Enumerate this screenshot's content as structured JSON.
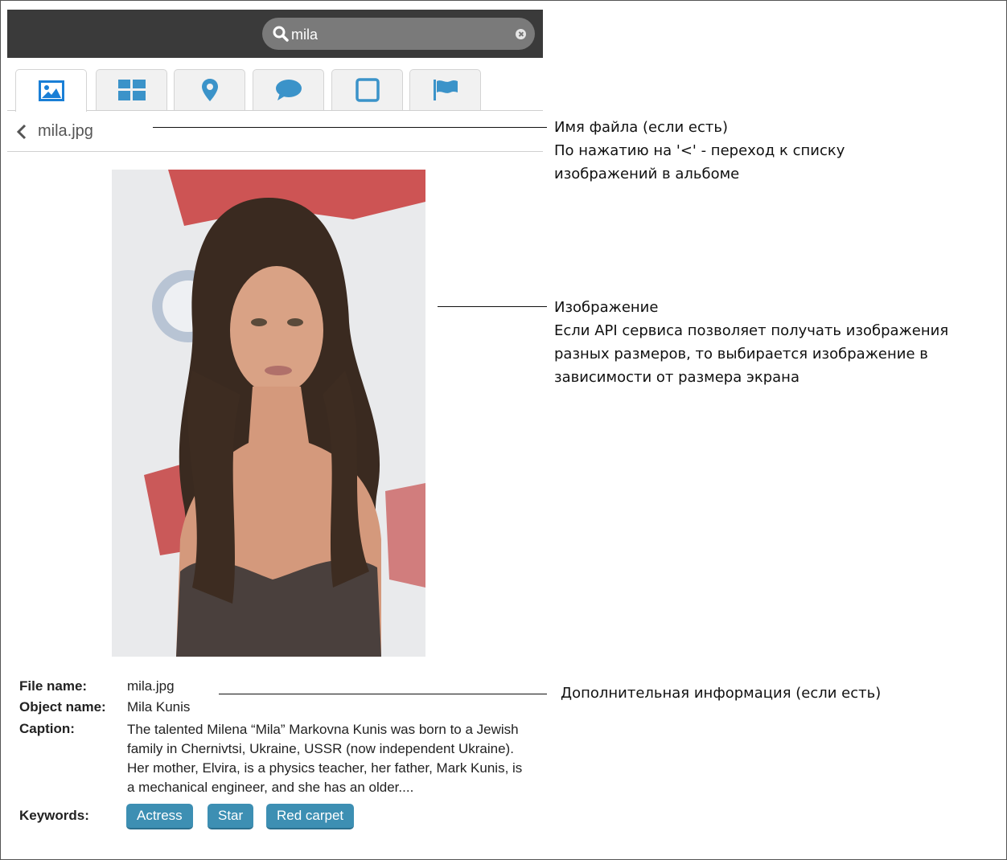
{
  "search": {
    "value": "mila",
    "placeholder": ""
  },
  "tabs": [
    {
      "icon": "image-icon",
      "active": true
    },
    {
      "icon": "grid-icon",
      "active": false
    },
    {
      "icon": "location-pin-icon",
      "active": false
    },
    {
      "icon": "comment-icon",
      "active": false
    },
    {
      "icon": "square-icon",
      "active": false
    },
    {
      "icon": "flag-icon",
      "active": false
    }
  ],
  "breadcrumb": {
    "back_symbol": "<",
    "file": "mila.jpg"
  },
  "photo": {
    "alt": "mila.jpg"
  },
  "info": {
    "file_name_label": "File name:",
    "file_name_value": "mila.jpg",
    "object_name_label": "Object name:",
    "object_name_value": "Mila Kunis",
    "caption_label": "Caption:",
    "caption_value": "The talented Milena “Mila” Markovna Kunis was born to a Jewish family in Chernivtsi, Ukraine, USSR (now independent Ukraine). Her mother, Elvira, is a physics teacher, her father, Mark Kunis, is a mechanical engineer, and she has an older....",
    "keywords_label": "Keywords:",
    "keywords": [
      "Actress",
      "Star",
      "Red carpet"
    ]
  },
  "annotations": {
    "filename_line1": "Имя файла (если есть)",
    "filename_line2": "По нажатию на '<' - переход к списку",
    "filename_line3": "изображений в альбоме",
    "image_line1": "Изображение",
    "image_line2": "Если API сервиса позволяет получать изображения",
    "image_line3": "разных размеров, то выбирается изображение в",
    "image_line4": "зависимости от размера экрана",
    "info_line1": "Дополнительная информация (если есть)"
  },
  "colors": {
    "topbar": "#3a3a3a",
    "accent": "#1a7fd6",
    "tab_icon": "#3b93c9",
    "tag": "#3d8fb3"
  }
}
